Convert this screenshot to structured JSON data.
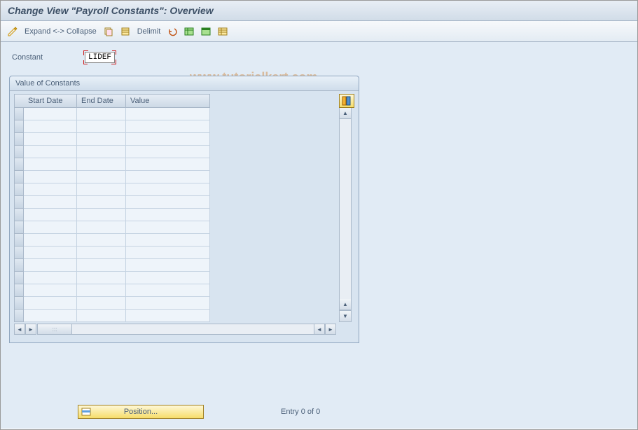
{
  "title": "Change View \"Payroll Constants\": Overview",
  "toolbar": {
    "expand_collapse": "Expand <-> Collapse",
    "delimit": "Delimit"
  },
  "field": {
    "label": "Constant",
    "value": "LIDEF"
  },
  "panel": {
    "title": "Value of Constants",
    "columns": {
      "start_date": "Start Date",
      "end_date": "End Date",
      "value": "Value"
    },
    "row_count": 17
  },
  "footer": {
    "position_label": "Position...",
    "entry_text": "Entry 0 of 0"
  },
  "watermark": "www.tutorialkart.com"
}
